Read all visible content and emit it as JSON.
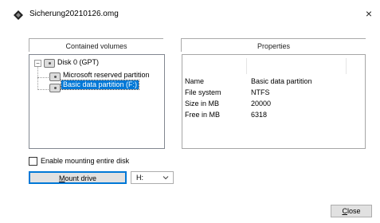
{
  "window": {
    "title": "Sicherung20210126.omg",
    "close_glyph": "×"
  },
  "volumes": {
    "header": "Contained volumes",
    "tree": {
      "disk_label": "Disk 0 (GPT)",
      "expander_glyph": "−",
      "partitions": [
        {
          "label": "Microsoft reserved partition",
          "selected": false
        },
        {
          "label": "Basic data partition (F:)",
          "selected": true
        }
      ]
    }
  },
  "properties": {
    "header": "Properties",
    "rows": [
      {
        "name": "Name",
        "value": "Basic data partition"
      },
      {
        "name": "File system",
        "value": "NTFS"
      },
      {
        "name": "Size in MB",
        "value": "20000"
      },
      {
        "name": "Free in MB",
        "value": "6318"
      }
    ]
  },
  "mount": {
    "checkbox_label": "Enable mounting entire disk",
    "checkbox_checked": false,
    "button_mnemonic": "M",
    "button_rest": "ount drive",
    "drive_selected": "H:"
  },
  "footer": {
    "close_mnemonic": "C",
    "close_rest": "lose"
  },
  "colors": {
    "selection": "#0078d7",
    "button_face": "#e1e1e1",
    "focus_border": "#0078d7"
  },
  "icons": {
    "app": "diamond-app-icon",
    "disk": "disk-icon",
    "dropdown": "chevron-down-icon"
  }
}
